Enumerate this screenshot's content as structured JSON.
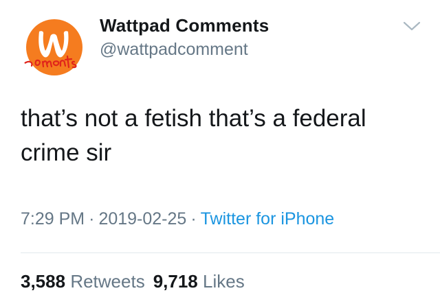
{
  "user": {
    "name": "Wattpad Comments",
    "handle": "@wattpadcomment",
    "avatar_logo_letter": "w",
    "avatar_scribble": "comments"
  },
  "tweet": {
    "text": "that’s not a fetish that’s a federal crime sir"
  },
  "meta": {
    "time": "7:29 PM",
    "date": "2019-02-25",
    "separator": "·",
    "source": "Twitter for iPhone"
  },
  "stats": {
    "retweets_count": "3,588",
    "retweets_label": "Retweets",
    "likes_count": "9,718",
    "likes_label": "Likes"
  },
  "colors": {
    "brand_orange": "#f57c1f",
    "link_blue": "#1b95e0",
    "secondary_gray": "#657786",
    "scribble_red": "#e0251b"
  },
  "icons": {
    "menu": "chevron-down-icon"
  }
}
